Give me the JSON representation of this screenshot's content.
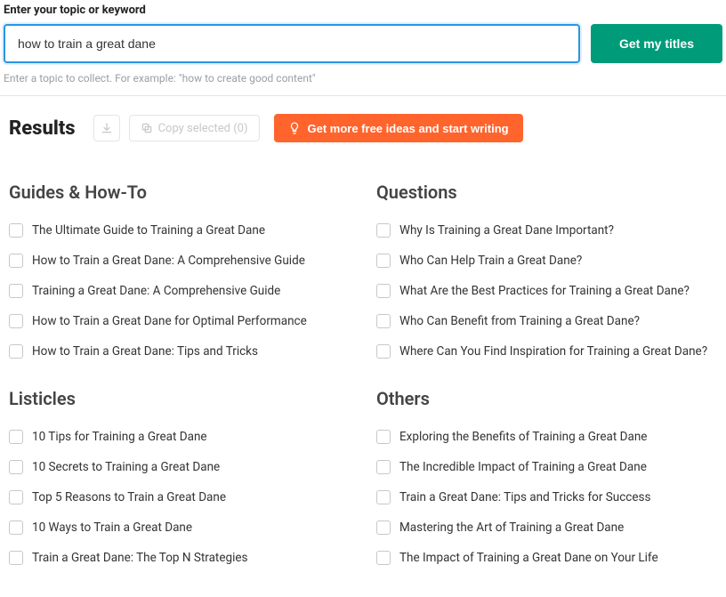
{
  "search": {
    "label": "Enter your topic or keyword",
    "value": "how to train a great dane",
    "hint": "Enter a topic to collect. For example: \"how to create good content\"",
    "button": "Get my titles"
  },
  "toolbar": {
    "results_title": "Results",
    "copy_selected": "Copy selected (0)",
    "cta": "Get more free ideas and start writing"
  },
  "left": [
    {
      "title": "Guides & How-To",
      "items": [
        "The Ultimate Guide to Training a Great Dane",
        "How to Train a Great Dane: A Comprehensive Guide",
        "Training a Great Dane: A Comprehensive Guide",
        "How to Train a Great Dane for Optimal Performance",
        "How to Train a Great Dane: Tips and Tricks"
      ]
    },
    {
      "title": "Listicles",
      "items": [
        "10 Tips for Training a Great Dane",
        "10 Secrets to Training a Great Dane",
        "Top 5 Reasons to Train a Great Dane",
        "10 Ways to Train a Great Dane",
        "Train a Great Dane: The Top N Strategies"
      ]
    }
  ],
  "right": [
    {
      "title": "Questions",
      "items": [
        "Why Is Training a Great Dane Important?",
        "Who Can Help Train a Great Dane?",
        "What Are the Best Practices for Training a Great Dane?",
        "Who Can Benefit from Training a Great Dane?",
        "Where Can You Find Inspiration for Training a Great Dane?"
      ]
    },
    {
      "title": "Others",
      "items": [
        "Exploring the Benefits of Training a Great Dane",
        "The Incredible Impact of Training a Great Dane",
        "Train a Great Dane: Tips and Tricks for Success",
        "Mastering the Art of Training a Great Dane",
        "The Impact of Training a Great Dane on Your Life"
      ]
    }
  ]
}
